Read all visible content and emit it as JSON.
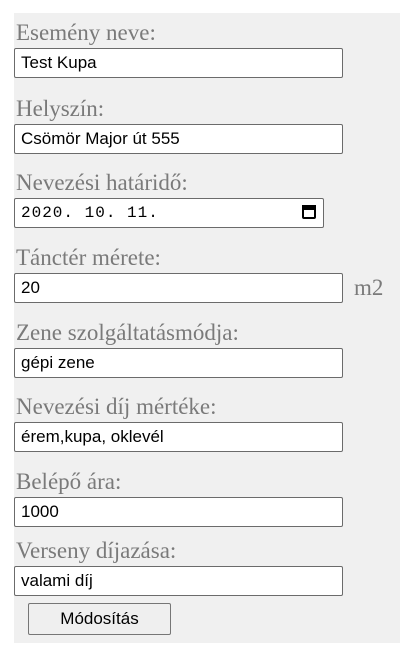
{
  "form": {
    "fields": [
      {
        "label": "Esemény neve:",
        "value": "Test Kupa"
      },
      {
        "label": "Helyszín:",
        "value": "Csömör Major út 555"
      },
      {
        "label": "Nevezési határidő:",
        "value": "2020. 10. 11."
      },
      {
        "label": "Tánctér mérete:",
        "value": "20",
        "unit": "m2"
      },
      {
        "label": "Zene szolgáltatásmódja:",
        "value": "gépi zene"
      },
      {
        "label": "Nevezési díj mértéke:",
        "value": "érem,kupa, oklevél"
      },
      {
        "label": "Belépő ára:",
        "value": "1000"
      },
      {
        "label": "Verseny díjazása:",
        "value": "valami díj"
      }
    ],
    "submit_label": "Módosítás",
    "date_icon": "calendar-icon"
  }
}
